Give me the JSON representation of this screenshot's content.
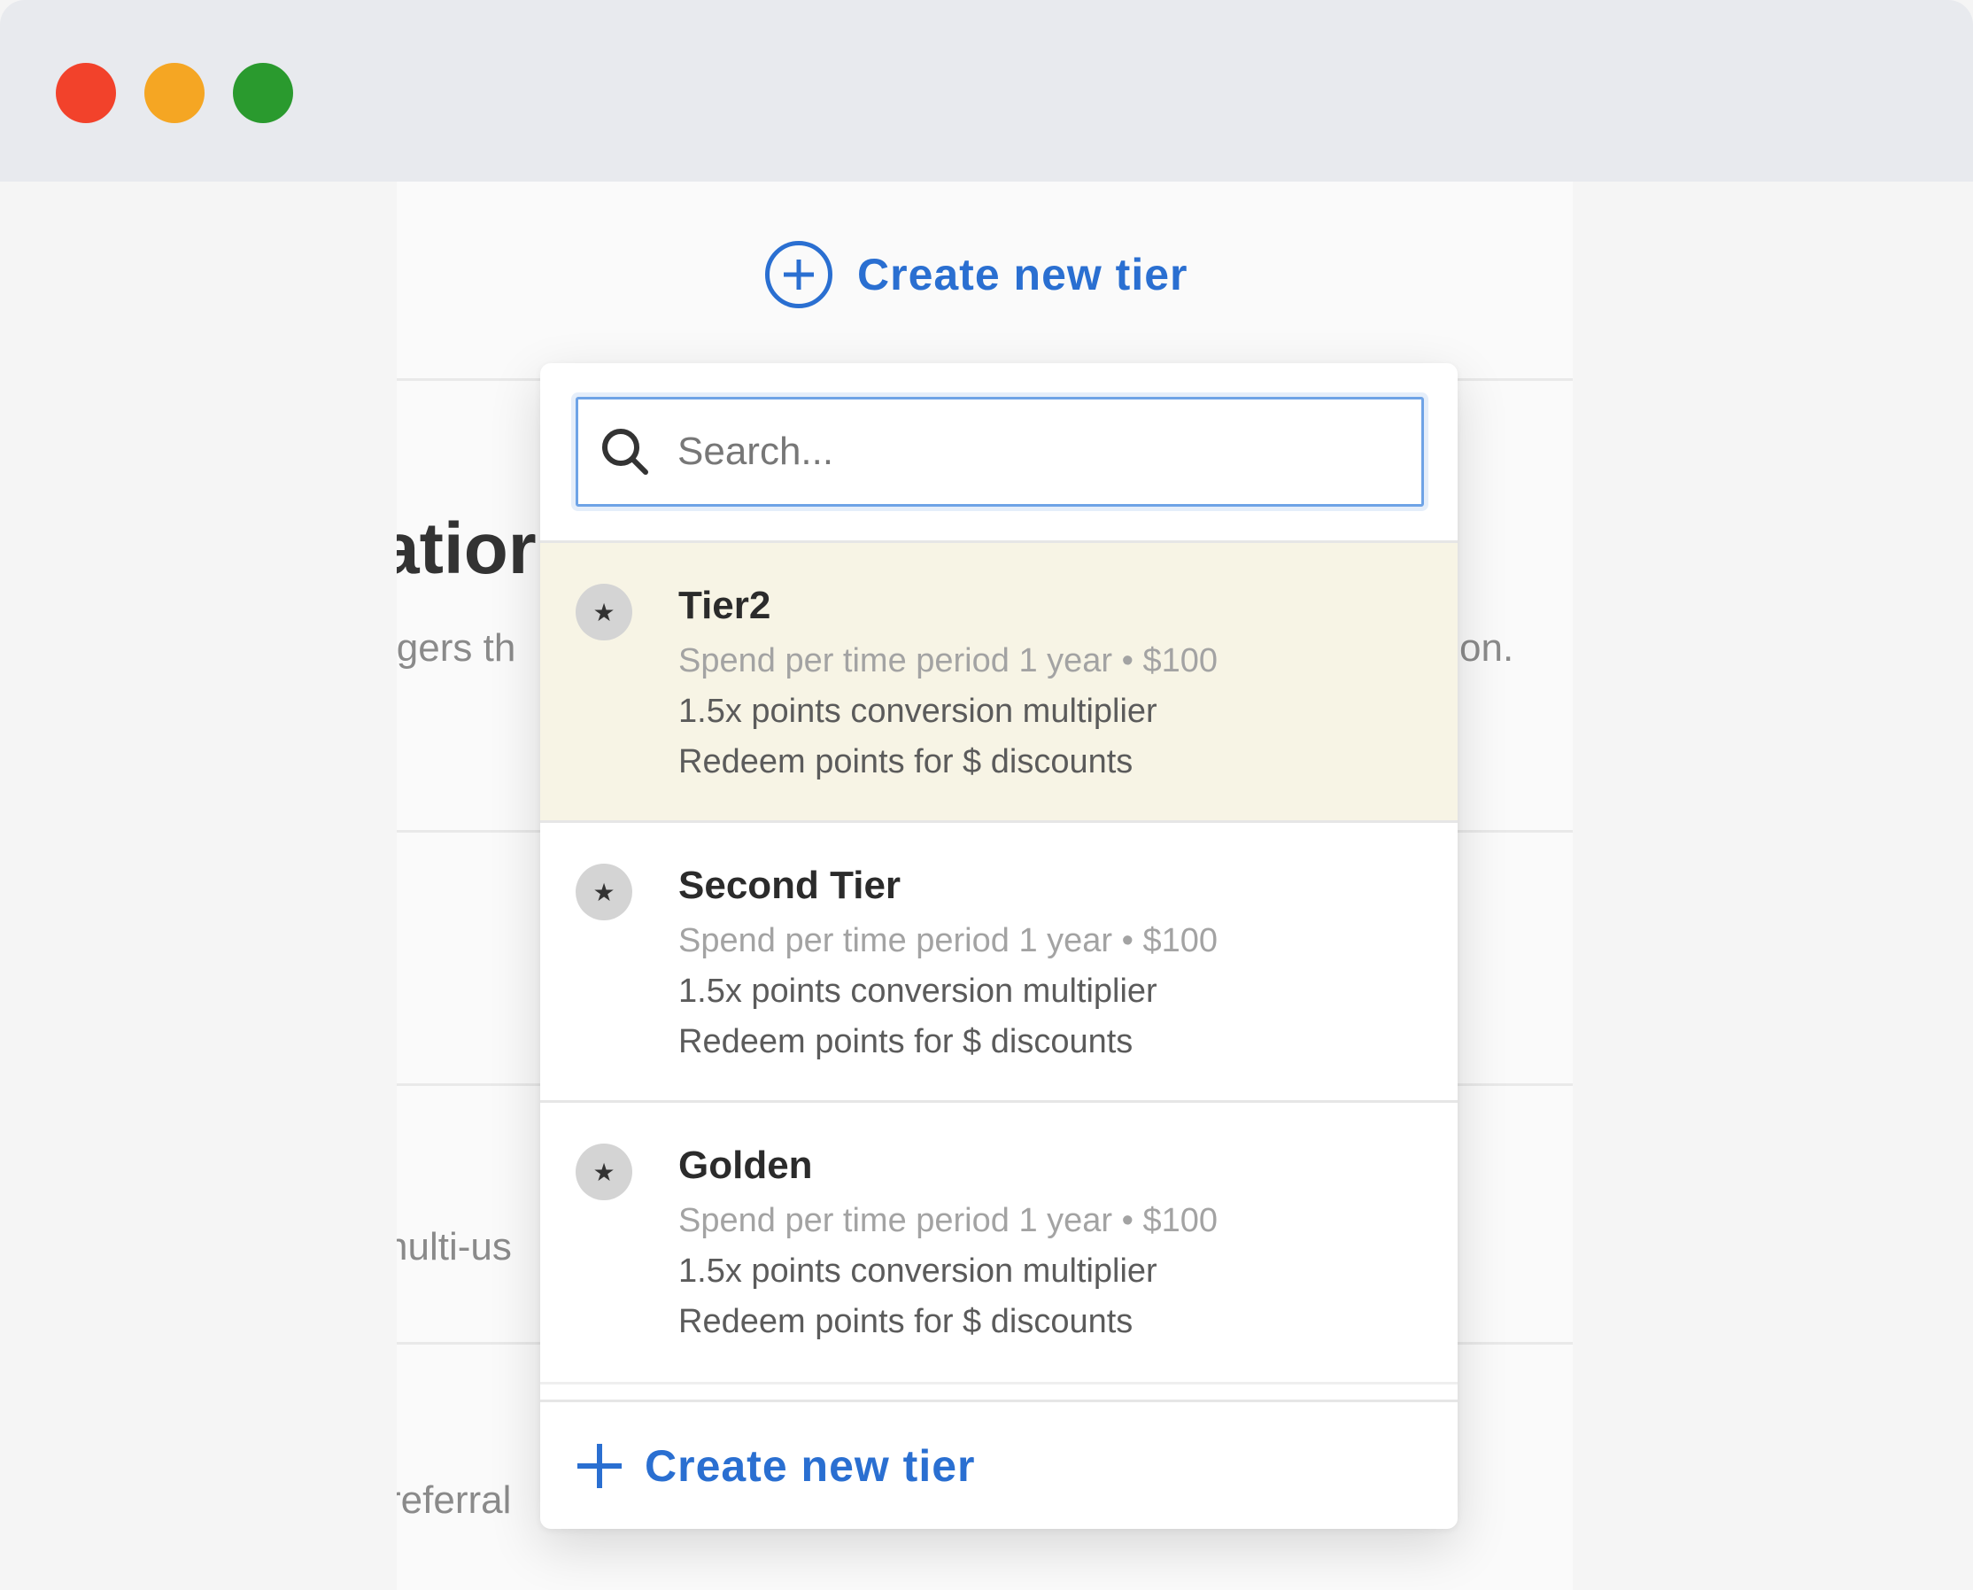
{
  "window": {
    "controls": [
      "close",
      "minimize",
      "maximize"
    ]
  },
  "background": {
    "heading_fragment": "atior",
    "text_fragment_1_left": "igers th",
    "text_fragment_1_right": "on.",
    "text_fragment_2": "nulti-us",
    "text_fragment_3": "referral"
  },
  "header": {
    "create_label": "Create new tier",
    "icon": "plus-circle-icon"
  },
  "dropdown": {
    "search": {
      "placeholder": "Search...",
      "value": "",
      "icon": "search-icon"
    },
    "items": [
      {
        "title": "Tier2",
        "spend": "Spend per time period 1 year • $100",
        "multiplier": "1.5x points conversion multiplier",
        "redeem": "Redeem points for $ discounts",
        "highlighted": true
      },
      {
        "title": "Second Tier",
        "spend": "Spend per time period 1 year • $100",
        "multiplier": "1.5x points conversion multiplier",
        "redeem": "Redeem points for $ discounts",
        "highlighted": false
      },
      {
        "title": "Golden",
        "spend": "Spend per time period 1 year • $100",
        "multiplier": "1.5x points conversion multiplier",
        "redeem": "Redeem points for $ discounts",
        "highlighted": false
      }
    ],
    "footer_create_label": "Create new tier"
  },
  "colors": {
    "accent": "#2a6fd1",
    "highlight": "#f7f4e5",
    "close": "#f2422b",
    "minimize": "#f5a623",
    "maximize": "#2a9a2e"
  }
}
